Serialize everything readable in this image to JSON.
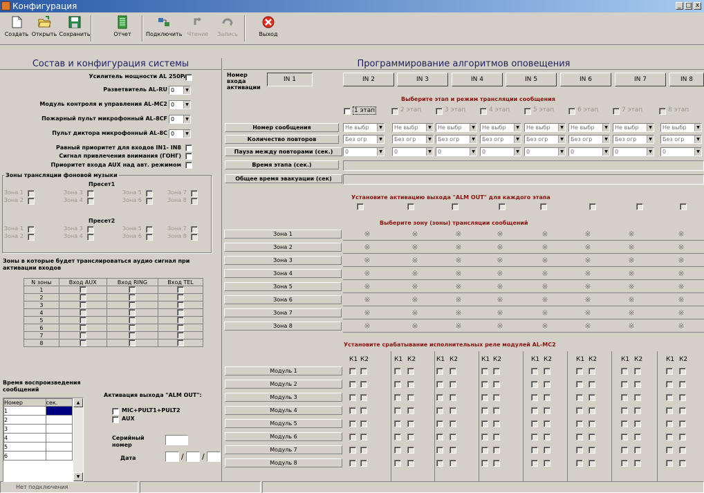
{
  "window": {
    "title": "Конфигурация",
    "min": "_",
    "max": "□",
    "close": "x"
  },
  "toolbar": [
    {
      "label": "Создать",
      "icon": "new-file-icon"
    },
    {
      "label": "Открыть",
      "icon": "open-folder-icon"
    },
    {
      "label": "Сохранить",
      "icon": "save-icon"
    },
    {
      "label": "Отчет",
      "icon": "report-icon"
    },
    {
      "label": "Подключить",
      "icon": "connect-icon"
    },
    {
      "label": "Чтение",
      "icon": "read-icon"
    },
    {
      "label": "Запись",
      "icon": "write-icon"
    },
    {
      "label": "Выход",
      "icon": "exit-icon"
    }
  ],
  "left": {
    "title": "Состав и конфигурация системы",
    "amp": "Усилитель мощности AL 250PA",
    "splitter": "Разветвитель AL-RU",
    "splitter_val": "0",
    "module": "Модуль контроля и управления AL-MC2",
    "module_val": "0",
    "firepult": "Пожарный пульт микрофонный AL-8CF",
    "firepult_val": "0",
    "dictpult": "Пульт диктора микрофонный AL-8C",
    "dictpult_val": "0",
    "equal": "Равный приоритет для входов IN1- IN8",
    "gong": "Сигнал привлечения внимания (ГОНГ)",
    "auxprio": "Приоритет входа AUX над авт. режимом",
    "bgzones": "Зоны трансляции фоновой музыки",
    "preset1": "Пресет1",
    "preset2": "Пресет2",
    "pz": [
      "Зона 1",
      "Зона 3",
      "Зона 5",
      "Зона 7",
      "Зона 2",
      "Зона 4",
      "Зона 6",
      "Зона 8"
    ],
    "audiozones": "Зоны в которые будет транслироваться аудио сигнал при активации входов",
    "zt_head": [
      "N зоны",
      "Вход AUX",
      "Вход RING",
      "Вход TEL"
    ],
    "zt_rows": [
      "1",
      "2",
      "3",
      "4",
      "5",
      "6",
      "7",
      "8"
    ],
    "playtime": "Время воспроизведения сообщений",
    "pt_head": [
      "Номер",
      "сек."
    ],
    "pt_rows": [
      "1",
      "2",
      "3",
      "4",
      "5",
      "6"
    ],
    "almout": "Активация выхода \"ALM OUT\":",
    "opt1": "MIC+PULT1+PULT2",
    "opt2": "AUX",
    "serial": "Серийный номер",
    "date": "Дата",
    "slash": "/"
  },
  "right": {
    "title": "Программирование алгоритмов оповещения",
    "input_label": "Номер входа активации",
    "tabs": [
      "IN 1",
      "IN 2",
      "IN 3",
      "IN 4",
      "IN 5",
      "IN 6",
      "IN 7",
      "IN 8"
    ],
    "stage_prompt": "Выберите этап и режим трансляции сообщения",
    "stages": [
      "1 этап",
      "2 этап",
      "3 этап",
      "4 этап",
      "5 этап",
      "6 этап",
      "7 этап",
      "8 этап"
    ],
    "rows": [
      "Номер сообщения",
      "Количество повторов",
      "Пауза между повторами (сек.)",
      "Время этапа (сек.)",
      "Общее время эвакуации (сек)"
    ],
    "msg_val": "Не выбр",
    "rep_val": "Без огр",
    "pause_val": "0",
    "alm_prompt": "Установите активацию выхода \"ALM OUT\" для каждого этапа",
    "zone_prompt": "Выберите зону (зоны) трансляции сообщений",
    "zones": [
      "Зона 1",
      "Зона 2",
      "Зона 3",
      "Зона 4",
      "Зона 5",
      "Зона 6",
      "Зона 7",
      "Зона 8"
    ],
    "zone_mark": "※",
    "relay_prompt": "Установите срабатывание исполнительных реле модулей AL-MC2",
    "k1": "К1",
    "k2": "К2",
    "modules": [
      "Модуль 1",
      "Модуль 2",
      "Модуль 3",
      "Модуль 4",
      "Модуль 5",
      "Модуль 6",
      "Модуль 7",
      "Модуль 8"
    ]
  },
  "status": {
    "text": "Нет подключения"
  }
}
